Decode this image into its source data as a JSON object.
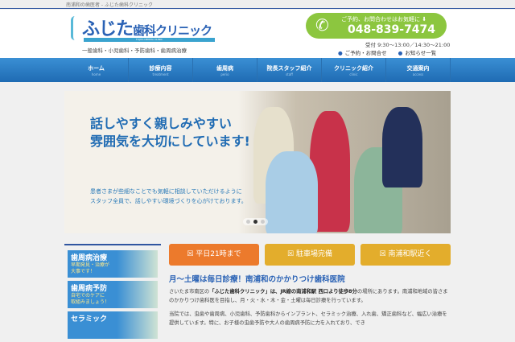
{
  "topbar": {
    "text": "南浦和の歯医者 - ふじた歯科クリニック"
  },
  "header": {
    "logo_main": "ふじた",
    "logo_sub": "歯科クリニック",
    "logo_en": "FUJITA DENTAL CLINIC",
    "tagline": "一般歯科・小児歯科・予防歯科・歯周病治療",
    "tel_label": "ご予約、お問合わせはお気軽に ⬇",
    "tel": "048-839-7474",
    "hours": "受付 9:30〜13:00／14:30〜21:00",
    "links": [
      "ご予約・お問合せ",
      "お知らせ一覧"
    ]
  },
  "nav": [
    {
      "label": "ホーム",
      "en": "home"
    },
    {
      "label": "診療内容",
      "en": "treatment"
    },
    {
      "label": "歯周病",
      "en": "perio"
    },
    {
      "label": "院長スタッフ紹介",
      "en": "staff"
    },
    {
      "label": "クリニック紹介",
      "en": "clinic"
    },
    {
      "label": "交通案内",
      "en": "access"
    }
  ],
  "hero": {
    "title1": "話しやすく親しみやすい",
    "title2": "雰囲気を大切にしています!",
    "text1": "患者さまが些細なことでも気軽に相談していただけるように",
    "text2": "スタッフ全員で、話しやすい環境づくりを心がけております。"
  },
  "sidebar": [
    {
      "title": "歯周病治療",
      "sub1": "早期発見・治療が",
      "sub2": "大事です！"
    },
    {
      "title": "歯周病予防",
      "sub1": "自宅でのケアに",
      "sub2": "取組みましょう！"
    },
    {
      "title": "セラミック",
      "sub1": "",
      "sub2": ""
    }
  ],
  "features": [
    {
      "label": "☒ 平日21時まで",
      "color": "#ec7a2c"
    },
    {
      "label": "☒ 駐車場完備",
      "color": "#e3ad2c"
    },
    {
      "label": "☒ 南浦和駅近く",
      "color": "#e3ad2c"
    }
  ],
  "content": {
    "heading": "月〜土曜は毎日診療！南浦和のかかりつけ歯科医院",
    "p1a": "さいたま市南区の",
    "p1b": "「ふじた歯科クリニック」は、JR線の南浦和駅 西口より徒歩8分",
    "p1c": "の場所にあります。南浦和地域の皆さまのかかりつけ歯科医を目指し、月・火・水・木・金・土曜は毎日診療を行っています。",
    "p2": "当院では、虫歯や歯周病、小児歯科、予防歯科からインプラント、セラミック治療、入れ歯、矯正歯科など、幅広い治療を提供しています。特に、お子様の虫歯予防や大人の歯周病予防に力を入れており、でき"
  }
}
